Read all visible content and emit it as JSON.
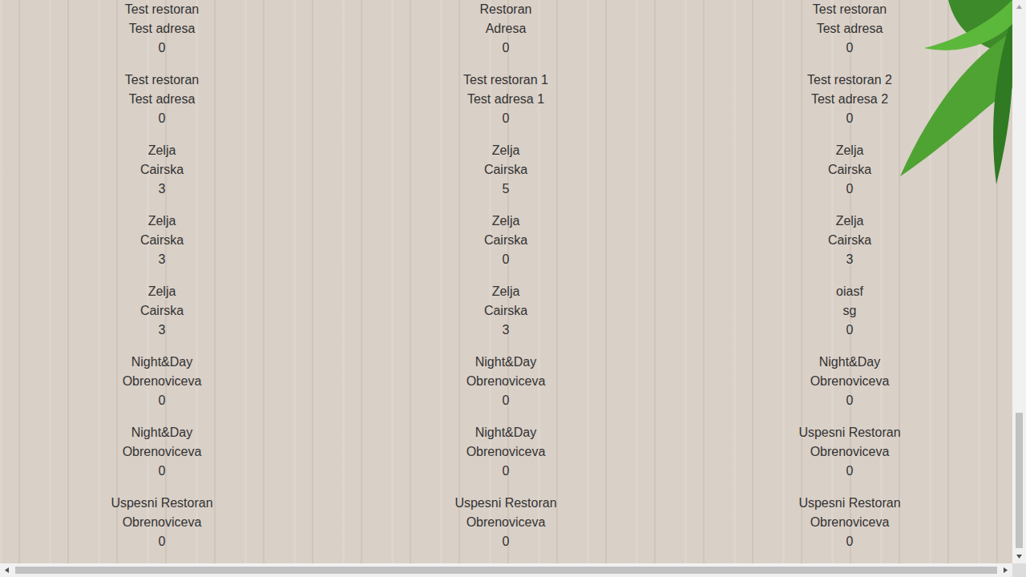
{
  "restaurants": [
    {
      "name": "Test restoran",
      "address": "Test adresa",
      "count": "0"
    },
    {
      "name": "Restoran",
      "address": "Adresa",
      "count": "0"
    },
    {
      "name": "Test restoran",
      "address": "Test adresa",
      "count": "0"
    },
    {
      "name": "Test restoran",
      "address": "Test adresa",
      "count": "0"
    },
    {
      "name": "Test restoran 1",
      "address": "Test adresa 1",
      "count": "0"
    },
    {
      "name": "Test restoran 2",
      "address": "Test adresa 2",
      "count": "0"
    },
    {
      "name": "Zelja",
      "address": "Cairska",
      "count": "3"
    },
    {
      "name": "Zelja",
      "address": "Cairska",
      "count": "5"
    },
    {
      "name": "Zelja",
      "address": "Cairska",
      "count": "0"
    },
    {
      "name": "Zelja",
      "address": "Cairska",
      "count": "3"
    },
    {
      "name": "Zelja",
      "address": "Cairska",
      "count": "0"
    },
    {
      "name": "Zelja",
      "address": "Cairska",
      "count": "3"
    },
    {
      "name": "Zelja",
      "address": "Cairska",
      "count": "3"
    },
    {
      "name": "Zelja",
      "address": "Cairska",
      "count": "3"
    },
    {
      "name": "oiasf",
      "address": "sg",
      "count": "0"
    },
    {
      "name": "Night&Day",
      "address": "Obrenoviceva",
      "count": "0"
    },
    {
      "name": "Night&Day",
      "address": "Obrenoviceva",
      "count": "0"
    },
    {
      "name": "Night&Day",
      "address": "Obrenoviceva",
      "count": "0"
    },
    {
      "name": "Night&Day",
      "address": "Obrenoviceva",
      "count": "0"
    },
    {
      "name": "Night&Day",
      "address": "Obrenoviceva",
      "count": "0"
    },
    {
      "name": "Uspesni Restoran",
      "address": "Obrenoviceva",
      "count": "0"
    },
    {
      "name": "Uspesni Restoran",
      "address": "Obrenoviceva",
      "count": "0"
    },
    {
      "name": "Uspesni Restoran",
      "address": "Obrenoviceva",
      "count": "0"
    },
    {
      "name": "Uspesni Restoran",
      "address": "Obrenoviceva",
      "count": "0"
    }
  ]
}
